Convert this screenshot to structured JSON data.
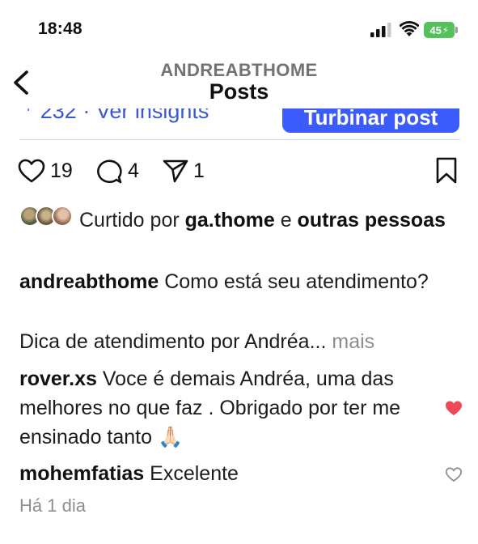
{
  "status_bar": {
    "time": "18:48",
    "battery": "45"
  },
  "header": {
    "username": "ANDREABTHOME",
    "title": "Posts"
  },
  "insights_strip": {
    "insights_text": "232 · Ver insights",
    "boost_label": "Turbinar post"
  },
  "actions": {
    "likes": "19",
    "comments": "4",
    "shares": "1"
  },
  "liked_by": {
    "prefix": "Curtido por ",
    "user": "ga.thome",
    "and": " e ",
    "others": "outras pessoas"
  },
  "caption": {
    "user": "andreabthome",
    "text": " Como está seu atendimento?",
    "line2": "Dica de atendimento por Andréa...",
    "more": " mais"
  },
  "comments": [
    {
      "user": "rover.xs",
      "text": " Voce é demais Andréa, uma das melhores no que faz . Obrigado por ter me ensinado tanto 🙏🏻",
      "liked": true
    },
    {
      "user": "mohemfatias",
      "text": " Excelente",
      "liked": false
    }
  ],
  "posted_ago": "Há 1 dia",
  "colors": {
    "accent": "#3b5bfa",
    "heart": "#ed4956",
    "muted": "#8e8e8e"
  }
}
